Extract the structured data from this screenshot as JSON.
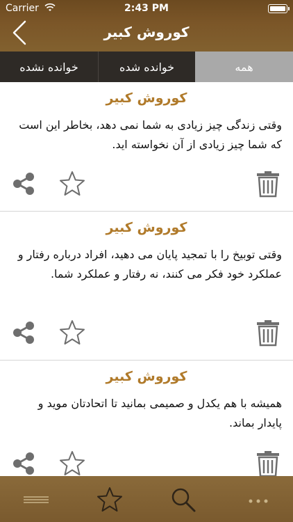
{
  "status": {
    "carrier": "Carrier",
    "time": "2:43 PM"
  },
  "nav": {
    "title": "کوروش کبیر"
  },
  "segments": {
    "all": "همه",
    "read": "خوانده شده",
    "unread": "خوانده نشده"
  },
  "quotes": [
    {
      "author": "کوروش کبیر",
      "text": "وقتی زندگی چیز زیادی به شما نمی دهد، بخاطر این است که شما چیز زیادی از آن نخواسته اید."
    },
    {
      "author": "کوروش کبیر",
      "text": "وقتی توبیخ را با تمجید پایان می دهید، افراد درباره رفتار و عملکرد خود فکر می کنند، نه رفتار و عملکرد شما."
    },
    {
      "author": "کوروش کبیر",
      "text": "همیشه با هم یکدل و صمیمی بمانید تا اتحادتان موید و پایدار بماند."
    }
  ],
  "icons": {
    "share": "share-icon",
    "favorite": "star-outline-icon",
    "delete": "trash-icon",
    "menu": "menu-icon",
    "favorites_tab": "star-icon",
    "search": "search-icon",
    "more": "more-icon"
  },
  "colors": {
    "header": "#7b5628",
    "segment_dark": "#2e2a26",
    "segment_selected": "#a9a9a9",
    "author": "#b07a2a",
    "icon_gray": "#6e6e6e"
  }
}
